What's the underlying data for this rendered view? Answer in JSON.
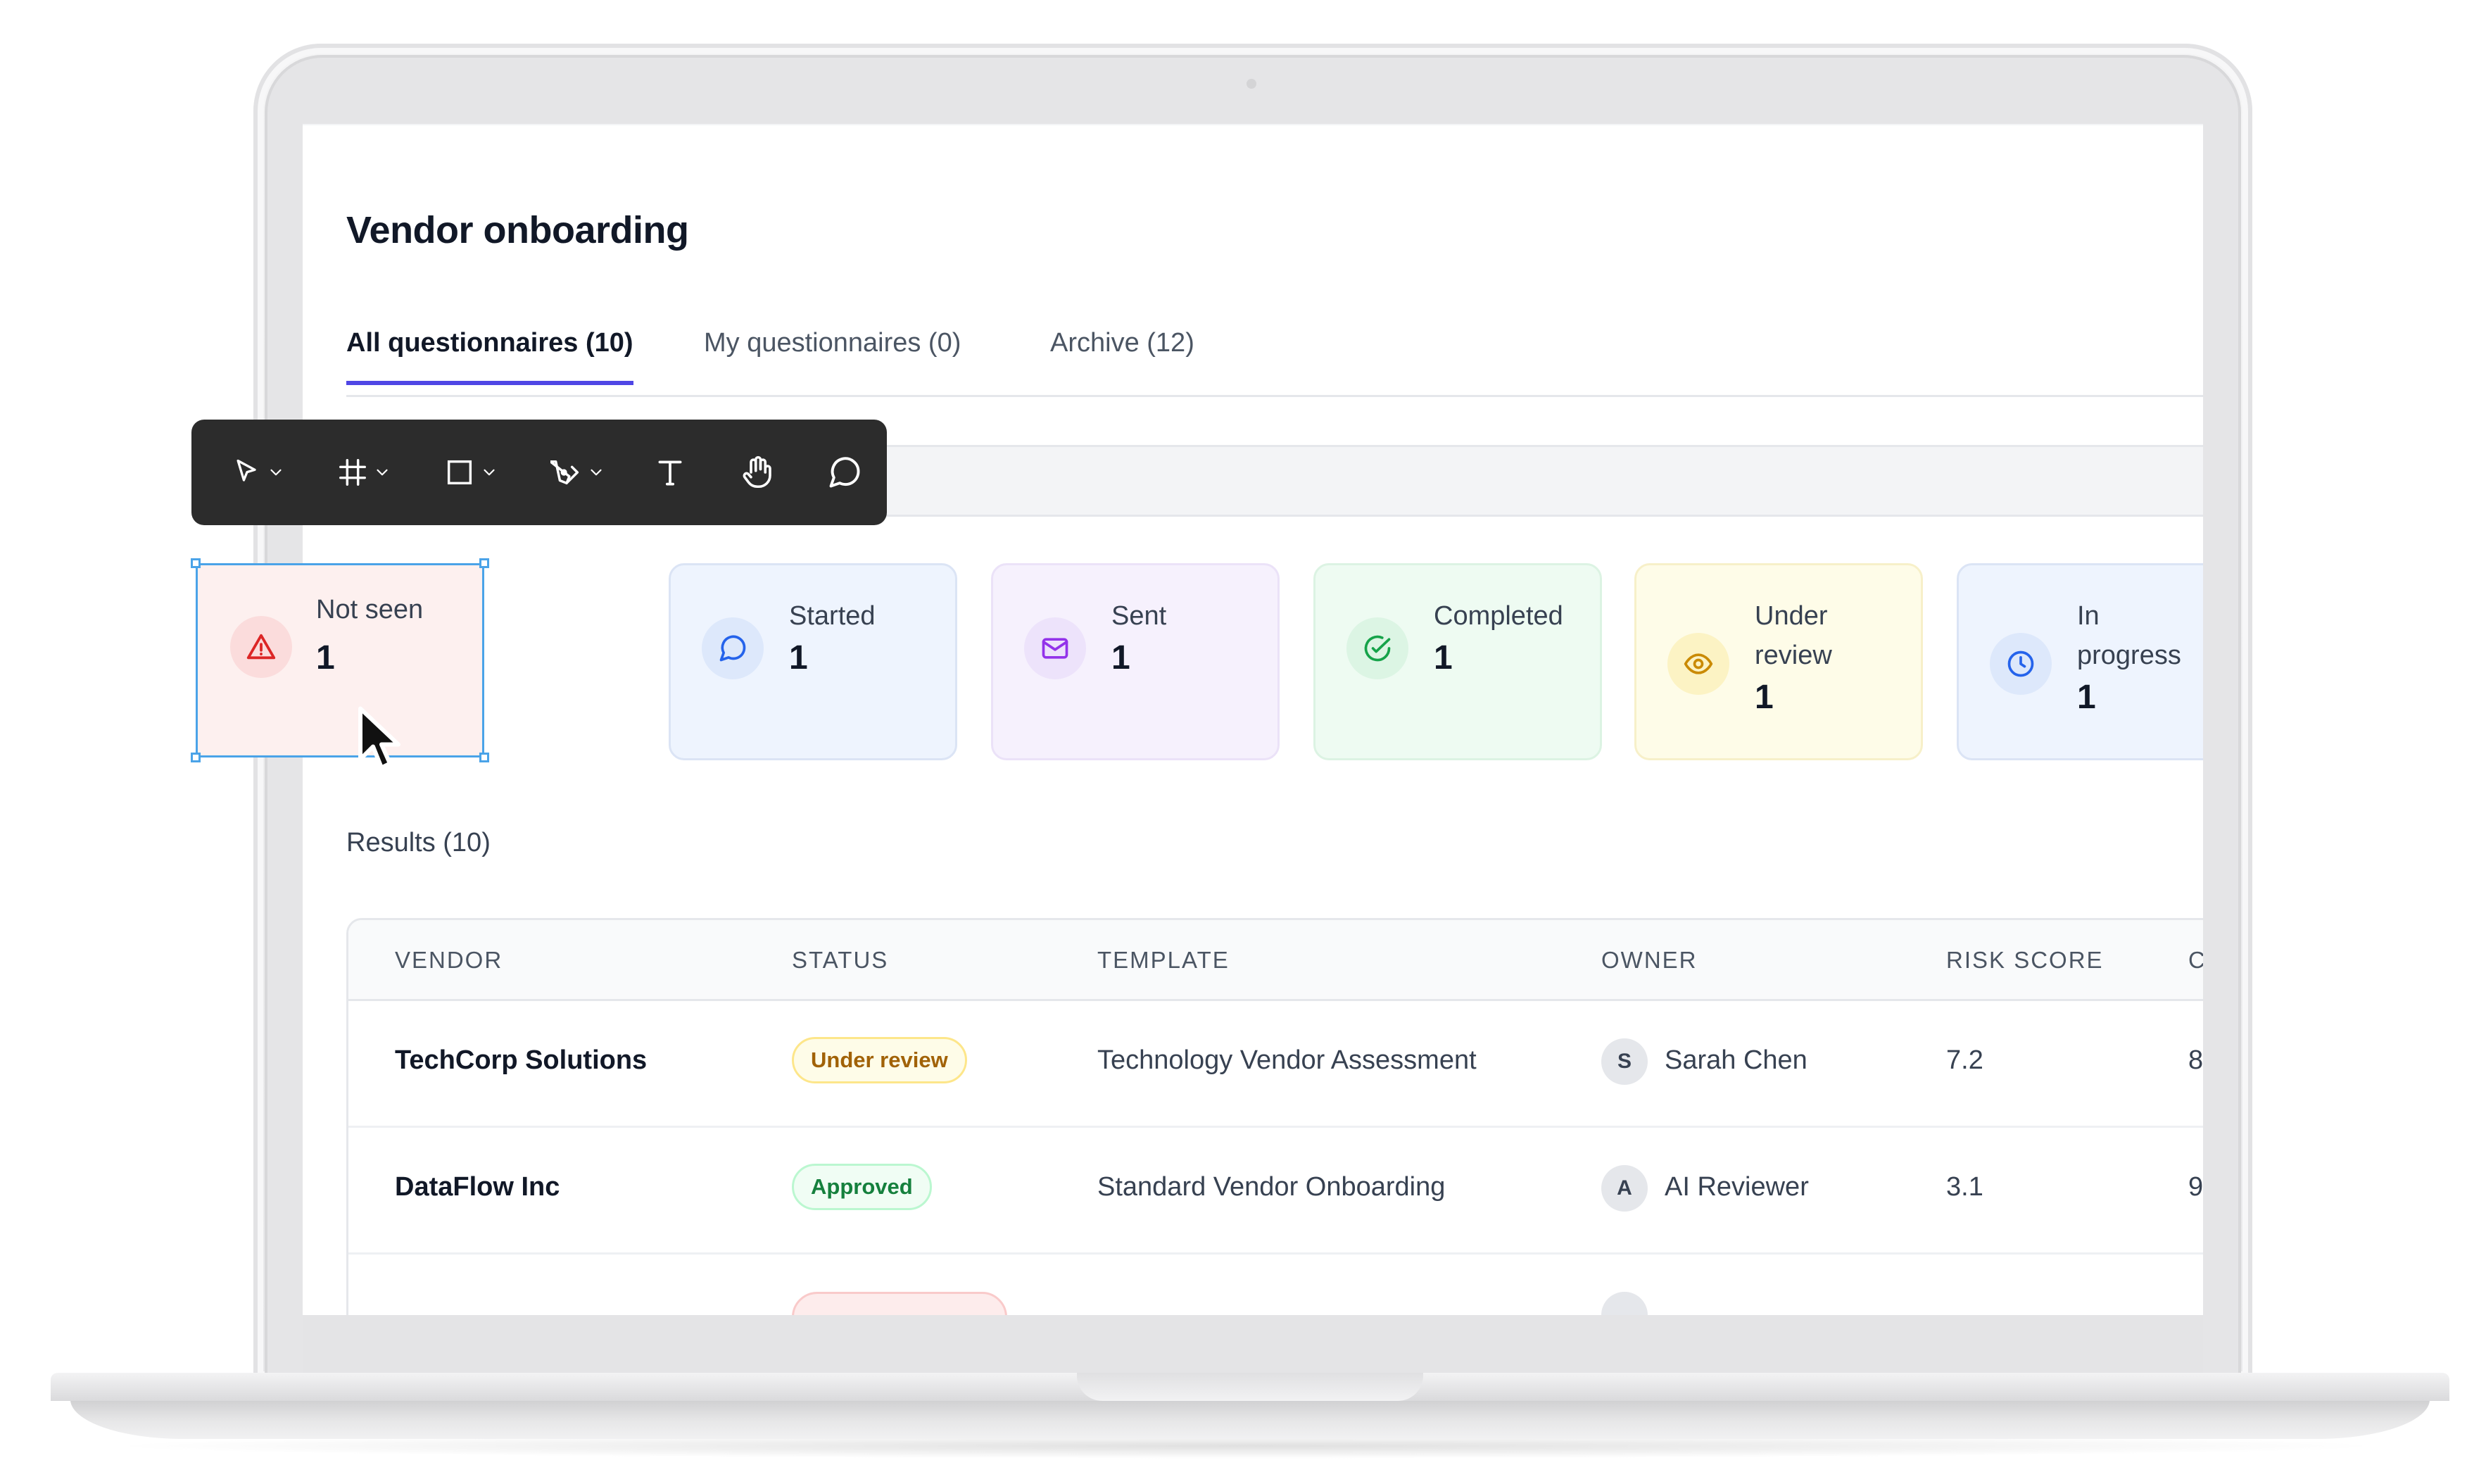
{
  "page": {
    "title": "Vendor onboarding"
  },
  "tabs": [
    {
      "label": "All questionnaires (10)",
      "active": true
    },
    {
      "label": "My questionnaires (0)",
      "active": false
    },
    {
      "label": "Archive (12)",
      "active": false
    }
  ],
  "toolbar": {
    "tools": [
      {
        "icon": "pointer-icon",
        "has_dropdown": true
      },
      {
        "icon": "frame-icon",
        "has_dropdown": true
      },
      {
        "icon": "rectangle-icon",
        "has_dropdown": true
      },
      {
        "icon": "pen-icon",
        "has_dropdown": true
      },
      {
        "icon": "text-icon",
        "has_dropdown": false
      },
      {
        "icon": "hand-icon",
        "has_dropdown": false
      },
      {
        "icon": "comment-icon",
        "has_dropdown": false
      }
    ]
  },
  "status_cards": [
    {
      "label": "Not seen",
      "count": "1",
      "icon": "warning-icon",
      "color": "#dc2626",
      "bg": "#fdf0ef"
    },
    {
      "label": "Started",
      "count": "1",
      "icon": "chat-icon",
      "color": "#2563eb",
      "bg": "#eef4fe"
    },
    {
      "label": "Sent",
      "count": "1",
      "icon": "mail-icon",
      "color": "#9333ea",
      "bg": "#f6f1fd"
    },
    {
      "label": "Completed",
      "count": "1",
      "icon": "check-circle-icon",
      "color": "#16a34a",
      "bg": "#eefbf2"
    },
    {
      "label_line1": "Under",
      "label_line2": "review",
      "count": "1",
      "icon": "eye-icon",
      "color": "#ca8a04",
      "bg": "#fefce8"
    },
    {
      "label_line1": "In",
      "label_line2": "progress",
      "count": "1",
      "icon": "clock-icon",
      "color": "#2563eb",
      "bg": "#eef4fe"
    }
  ],
  "results": {
    "label": "Results (10)"
  },
  "table": {
    "headers": [
      "VENDOR",
      "STATUS",
      "TEMPLATE",
      "OWNER",
      "RISK SCORE",
      "C"
    ],
    "rows": [
      {
        "vendor": "TechCorp Solutions",
        "status": "Under review",
        "status_color": "#a16207",
        "status_bg": "#fefce8",
        "status_border": "#fde68a",
        "template": "Technology Vendor Assessment",
        "owner_initial": "S",
        "owner": "Sarah Chen",
        "risk": "7.2",
        "extra": "8"
      },
      {
        "vendor": "DataFlow Inc",
        "status": "Approved",
        "status_color": "#15803d",
        "status_bg": "#f0fdf4",
        "status_border": "#bbf7d0",
        "template": "Standard Vendor Onboarding",
        "owner_initial": "A",
        "owner": "AI Reviewer",
        "risk": "3.1",
        "extra": "9"
      }
    ]
  },
  "colors": {
    "accent": "#4f46e5",
    "selection": "#4aa3e8",
    "toolbar_bg": "#2c2c2c"
  }
}
